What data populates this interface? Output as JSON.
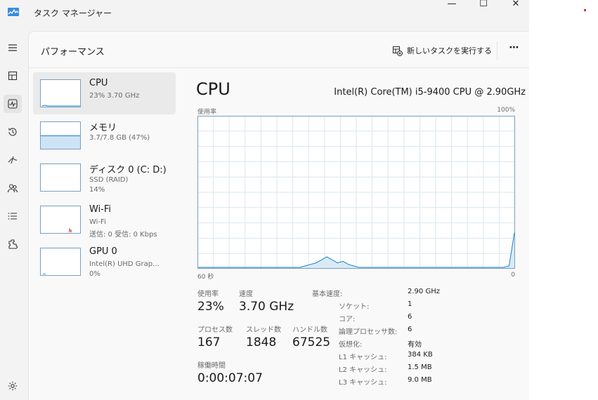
{
  "window": {
    "title": "タスク マネージャー",
    "controls": {
      "minimize": "—",
      "maximize": "☐",
      "close": "✕"
    }
  },
  "header": {
    "page_title": "パフォーマンス",
    "run_task_label": "新しいタスクを実行する",
    "more_label": "⋯"
  },
  "nav": {
    "items": [
      "menu-icon",
      "processes-icon",
      "performance-icon",
      "app-history-icon",
      "startup-apps-icon",
      "users-icon",
      "details-icon",
      "services-icon",
      "settings-icon"
    ],
    "active": "performance-icon"
  },
  "perf_list": [
    {
      "name": "CPU",
      "sub1": "23%  3.70 GHz",
      "sub2": ""
    },
    {
      "name": "メモリ",
      "sub1": "3.7/7.8 GB (47%)",
      "sub2": ""
    },
    {
      "name": "ディスク 0 (C: D:)",
      "sub1": "SSD (RAID)",
      "sub2": "14%"
    },
    {
      "name": "Wi-Fi",
      "sub1": "Wi-Fi",
      "sub2": "送信: 0 受信: 0 Kbps"
    },
    {
      "name": "GPU 0",
      "sub1": "Intel(R) UHD Grap...",
      "sub2": "0%"
    }
  ],
  "main": {
    "title": "CPU",
    "model": "Intel(R) Core(TM) i5-9400 CPU @ 2.90GHz",
    "graph_top_left": "使用率",
    "graph_top_right": "100%",
    "graph_bottom_left": "60 秒",
    "graph_bottom_right": "0"
  },
  "stats": {
    "usage_label": "使用率",
    "usage_value": "23%",
    "speed_label": "速度",
    "speed_value": "3.70 GHz",
    "processes_label": "プロセス数",
    "processes_value": "167",
    "threads_label": "スレッド数",
    "threads_value": "1848",
    "handles_label": "ハンドル数",
    "handles_value": "67525",
    "uptime_label": "稼働時間",
    "uptime_value": "0:00:07:07"
  },
  "specs": [
    {
      "key": "基本速度:",
      "value": "2.90 GHz"
    },
    {
      "key": "ソケット:",
      "value": "1"
    },
    {
      "key": "コア:",
      "value": "6"
    },
    {
      "key": "論理プロセッサ数:",
      "value": "6"
    },
    {
      "key": "仮想化:",
      "value": "有効"
    },
    {
      "key": "L1 キャッシュ:",
      "value": "384 KB"
    },
    {
      "key": "L2 キャッシュ:",
      "value": "1.5 MB"
    },
    {
      "key": "L3 キャッシュ:",
      "value": "9.0 MB"
    }
  ],
  "colors": {
    "graph_line": "#1a82c4",
    "graph_fill": "#d9eaf6",
    "graph_grid": "#dbe6ee",
    "graph_border": "#7a9fc0",
    "memory_fill": "#cfe3f6"
  },
  "cpu_usage_history_percent": [
    0,
    0,
    0,
    0,
    0,
    0,
    0,
    0,
    0,
    0,
    0,
    0,
    0,
    0,
    0,
    0,
    0,
    0,
    0,
    0,
    1,
    2,
    3,
    5,
    7,
    5,
    3,
    4,
    2,
    1,
    0,
    0,
    0,
    0,
    0,
    0,
    0,
    0,
    0,
    0,
    0,
    0,
    0,
    0,
    0,
    0,
    0,
    0,
    0,
    0,
    0,
    0,
    0,
    0,
    0,
    0,
    0,
    0,
    1,
    23
  ]
}
